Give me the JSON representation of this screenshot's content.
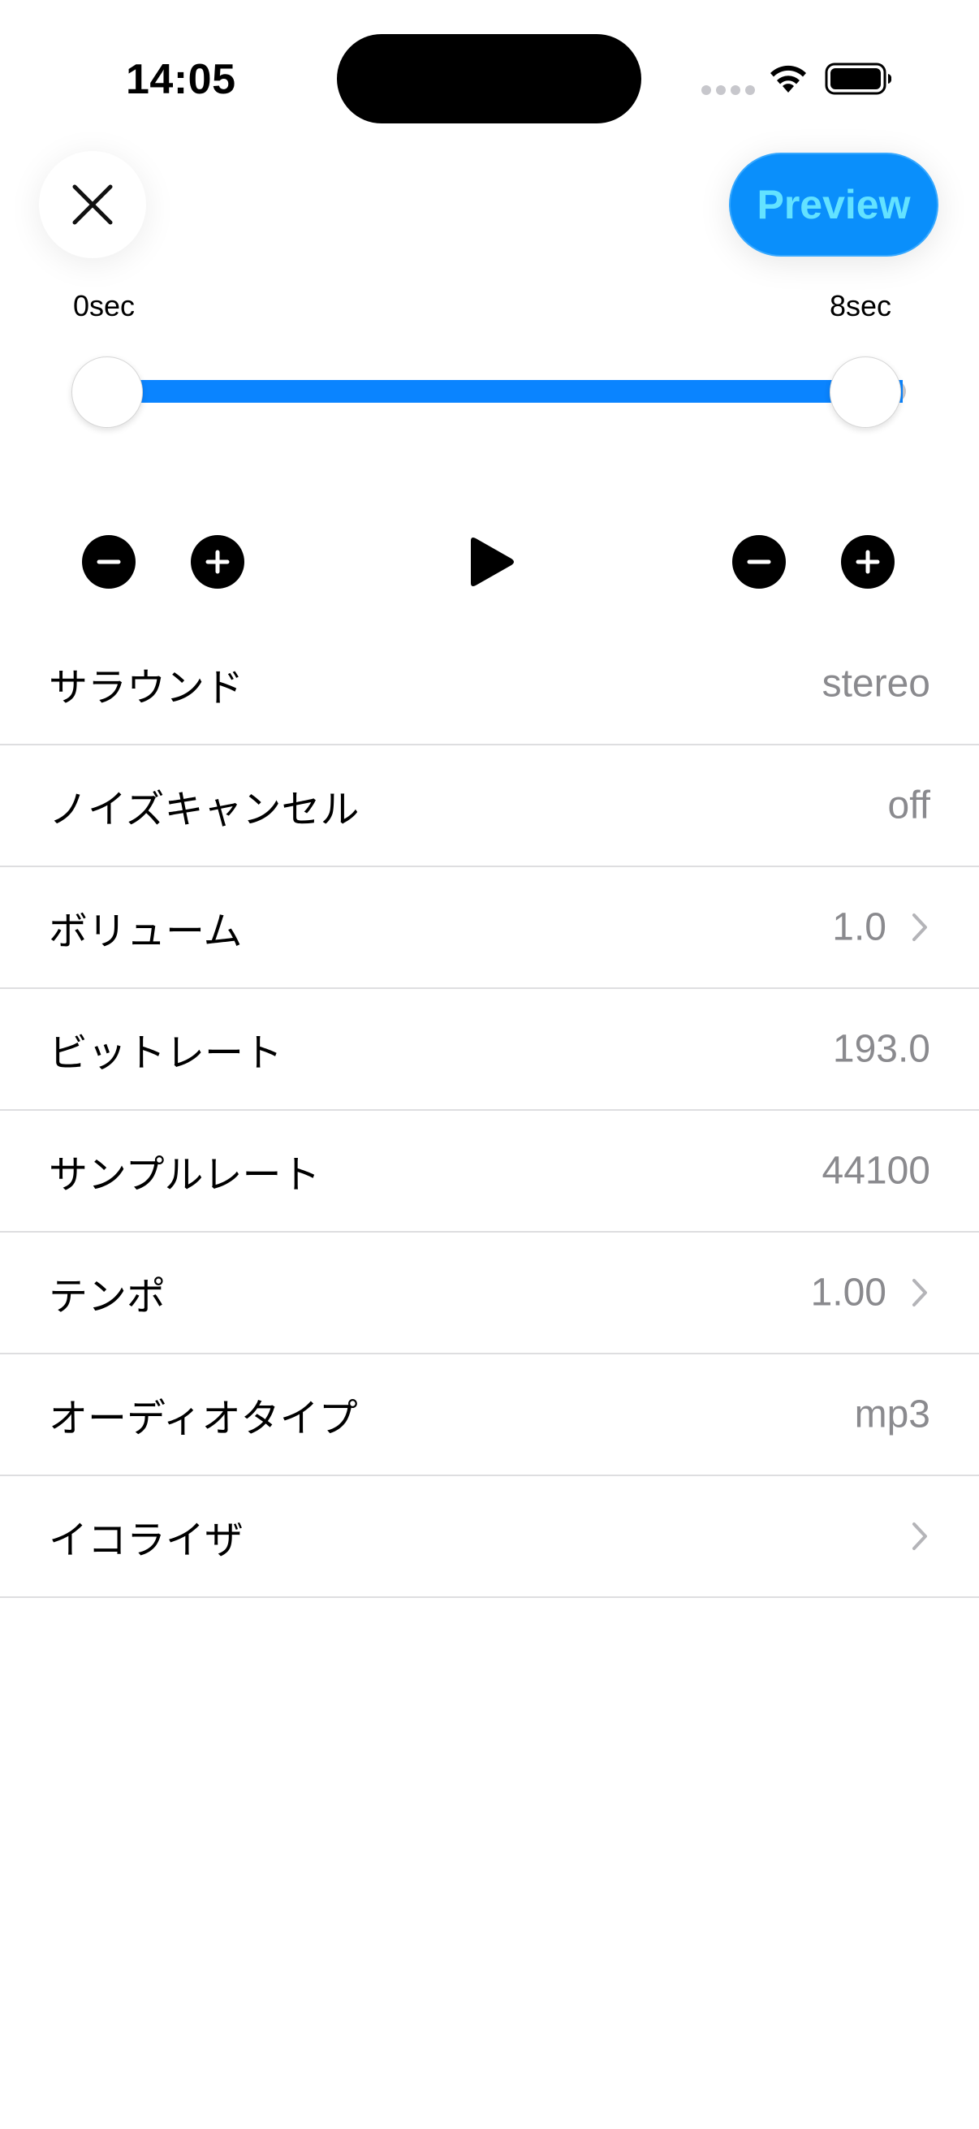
{
  "status_bar": {
    "time": "14:05"
  },
  "header": {
    "close_icon": "close-icon",
    "preview_label": "Preview"
  },
  "range": {
    "start_label": "0sec",
    "end_label": "8sec",
    "start_fraction": 0.0,
    "end_fraction": 1.0
  },
  "colors": {
    "accent": "#0a84ff",
    "preview_text": "#63e2ff",
    "secondary_text": "#8a8a8e"
  },
  "controls": {
    "left_minus_icon": "minus-icon",
    "left_plus_icon": "plus-icon",
    "play_icon": "play-icon",
    "right_minus_icon": "minus-icon",
    "right_plus_icon": "plus-icon"
  },
  "settings": [
    {
      "label": "サラウンド",
      "value": "stereo",
      "chevron": false
    },
    {
      "label": "ノイズキャンセル",
      "value": "off",
      "chevron": false
    },
    {
      "label": "ボリューム",
      "value": "1.0",
      "chevron": true
    },
    {
      "label": "ビットレート",
      "value": "193.0",
      "chevron": false
    },
    {
      "label": "サンプルレート",
      "value": "44100",
      "chevron": false
    },
    {
      "label": "テンポ",
      "value": "1.00",
      "chevron": true
    },
    {
      "label": "オーディオタイプ",
      "value": "mp3",
      "chevron": false
    },
    {
      "label": "イコライザ",
      "value": "",
      "chevron": true
    }
  ]
}
